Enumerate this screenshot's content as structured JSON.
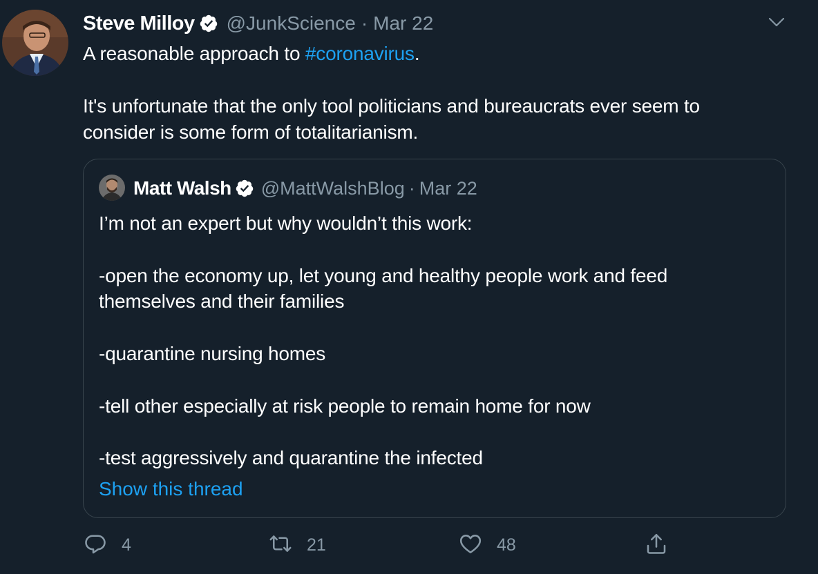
{
  "tweet": {
    "author": {
      "name": "Steve Milloy",
      "handle": "@JunkScience",
      "date": "Mar 22"
    },
    "text": {
      "line1_prefix": "A reasonable approach to ",
      "hashtag": "#coronavirus",
      "line1_suffix": ".",
      "paragraph2": "It's unfortunate that the only tool politicians and bureaucrats ever seem to consider is some form of totalitarianism."
    },
    "separator": "·"
  },
  "quote": {
    "author": {
      "name": "Matt Walsh",
      "handle": "@MattWalshBlog",
      "date": "Mar 22"
    },
    "separator": "·",
    "paragraphs": [
      "I’m not an expert but why wouldn’t this work:",
      "-open the economy up, let young and healthy people work and feed themselves and their families",
      "-quarantine nursing homes",
      "-tell other especially at risk people to remain home for now",
      "-test aggressively and quarantine the infected"
    ],
    "show_thread": "Show this thread"
  },
  "actions": {
    "reply": {
      "icon": "reply-icon",
      "count": "4"
    },
    "retweet": {
      "icon": "retweet-icon",
      "count": "21"
    },
    "like": {
      "icon": "heart-icon",
      "count": "48"
    },
    "share": {
      "icon": "share-icon"
    }
  },
  "colors": {
    "background": "#15202b",
    "text": "#ffffff",
    "secondary": "#8899a6",
    "accent": "#1da1f2",
    "border": "#38444d"
  }
}
